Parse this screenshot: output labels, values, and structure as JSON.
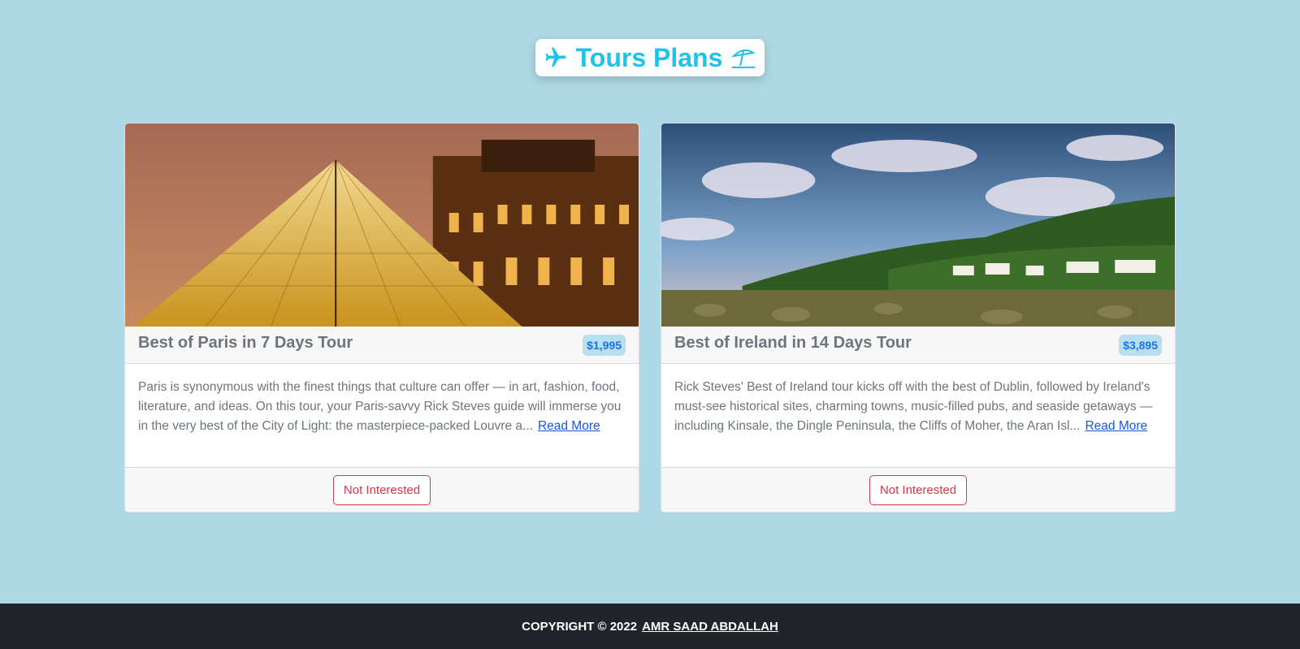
{
  "header": {
    "title": "Tours Plans",
    "left_icon": "airplane-icon",
    "right_icon": "beach-umbrella-icon",
    "accent_color": "#1ec3e6"
  },
  "tours": [
    {
      "title": "Best of Paris in 7 Days Tour",
      "price": "$1,995",
      "description": "Paris is synonymous with the finest things that culture can offer — in art, fashion, food, literature, and ideas. On this tour, your Paris-savvy Rick Steves guide will immerse you in the very best of the City of Light: the masterpiece-packed Louvre a...",
      "read_more": "Read More",
      "button": "Not Interested"
    },
    {
      "title": "Best of Ireland in 14 Days Tour",
      "price": "$3,895",
      "description": "Rick Steves' Best of Ireland tour kicks off with the best of Dublin, followed by Ireland's must-see historical sites, charming towns, music-filled pubs, and seaside getaways — including Kinsale, the Dingle Peninsula, the Cliffs of Moher, the Aran Isl...",
      "read_more": "Read More",
      "button": "Not Interested"
    }
  ],
  "footer": {
    "copyright": "COPYRIGHT © 2022",
    "author": "AMR SAAD ABDALLAH"
  },
  "colors": {
    "background": "#add8e6",
    "price_badge": "#b7dff0",
    "danger": "#dc3545",
    "footer_bg": "#212529"
  }
}
